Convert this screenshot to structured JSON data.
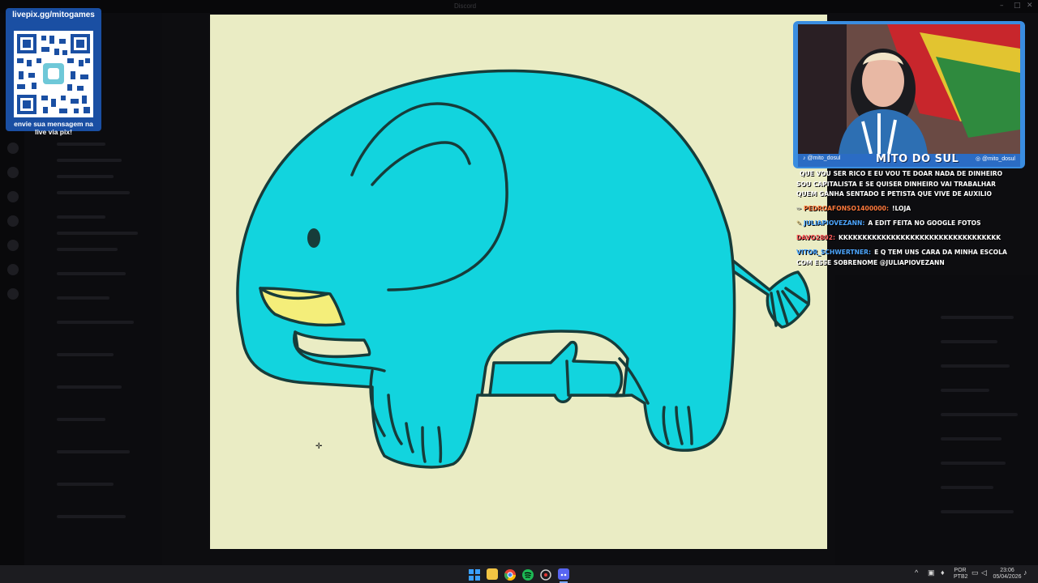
{
  "window": {
    "title": "Discord",
    "minimize": "–",
    "maximize": "□",
    "close": "✕"
  },
  "qr_card": {
    "title": "livepix.gg/mitogames",
    "caption_line1": "envie sua mensagem na",
    "caption_line2": "live via pix!"
  },
  "webcam": {
    "handle_left": "@mito_dosul",
    "streamer_name": "MITO DO SUL",
    "handle_right": "@mito_dosul"
  },
  "chat": [
    {
      "user": "",
      "user_color": "#ffffff",
      "text": "QUE VOU SER RICO E EU VOU TE DOAR NADA DE DINHEIRO SOU CAPITALISTA E SE QUISER DINHEIRO VAI TRABALHAR QUEM GANHA SENTADO E PETISTA QUE VIVE DE AUXILIO"
    },
    {
      "user": "PEDROAFONSO1400000:",
      "user_color": "#ff7a3d",
      "text": "!LOJA"
    },
    {
      "user": "JULIAPIOVEZANN:",
      "user_color": "#4da6ff",
      "text": "A EDIT FEITA NO GOOGLE FOTOS"
    },
    {
      "user": "DAVO2802:",
      "user_color": "#ff5a5a",
      "text": "KKKKKKKKKKKKKKKKKKKKKKKKKKKKKKKKKK"
    },
    {
      "user": "VITOR_SCHWERTNER:",
      "user_color": "#4da6ff",
      "text": "E Q TEM UNS CARA DA MINHA ESCOLA COM ESSE SOBRENOME @JULIAPIOVEZANN"
    }
  ],
  "tray": {
    "lang_line1": "POR",
    "lang_line2": "PTB2",
    "time": "23:06",
    "date": "05/04/2026"
  },
  "colors": {
    "canvas_bg": "#eaecc4",
    "elephant_body": "#12d4de",
    "elephant_tusk": "#f4ee7a",
    "outline": "#173c3a",
    "qr_card_bg": "#1a4fa3"
  },
  "icons": [
    "start-icon",
    "file-explorer-icon",
    "chrome-icon",
    "spotify-icon",
    "game-launcher-icon",
    "discord-icon"
  ]
}
